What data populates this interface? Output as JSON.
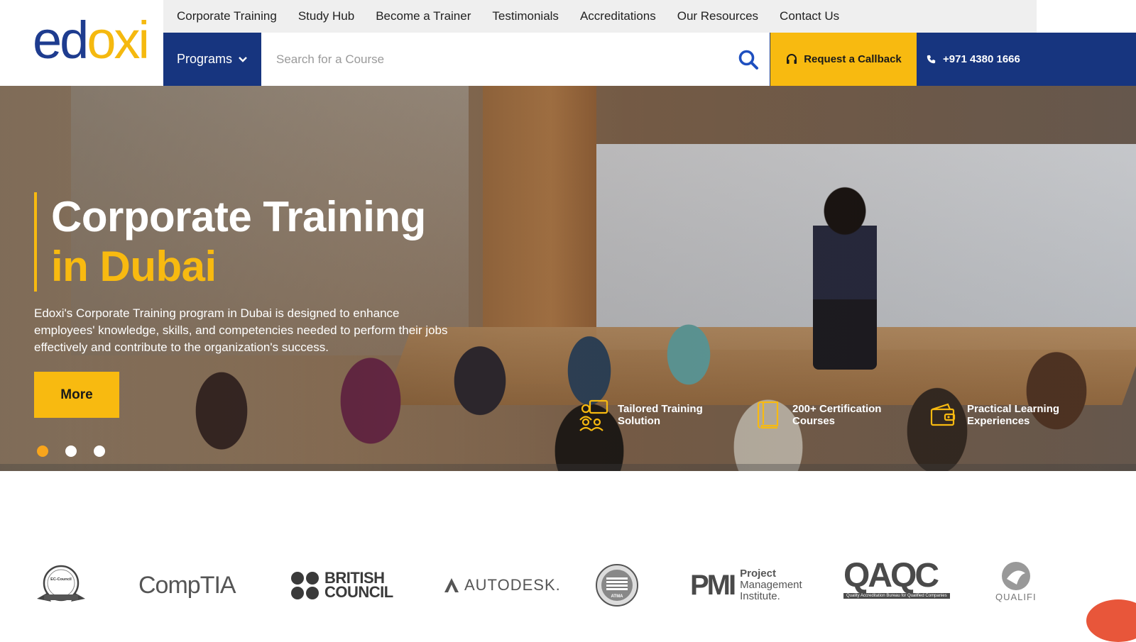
{
  "brand": {
    "logo_ed": "ed",
    "logo_o": "o",
    "logo_xi": "xi",
    "accent": "#f8ba10",
    "primary": "#17357f"
  },
  "topnav": [
    "Corporate Training",
    "Study Hub",
    "Become a Trainer",
    "Testimonials",
    "Accreditations",
    "Our Resources",
    "Contact Us"
  ],
  "header": {
    "programs_label": "Programs",
    "search_placeholder": "Search for a Course",
    "callback_label": "Request a Callback",
    "phone": "+971 4380 1666"
  },
  "hero": {
    "title_line1": "Corporate Training",
    "title_line2": "in Dubai",
    "description": "Edoxi's Corporate Training program in Dubai is designed to enhance employees' knowledge, skills, and competencies needed to perform their jobs effectively and contribute to the organization's success.",
    "cta": "More",
    "slides": 3,
    "active_slide": 1,
    "features": [
      {
        "icon": "training-icon",
        "text": "Tailored Training Solution"
      },
      {
        "icon": "book-icon",
        "text": "200+ Certification Courses"
      },
      {
        "icon": "wallet-icon",
        "text": "Practical Learning Experiences"
      }
    ]
  },
  "partners": {
    "ec_council": "EC-Council",
    "comptia": "CompTIA",
    "british_council_1": "BRITISH",
    "british_council_2": "COUNCIL",
    "autodesk": "AUTODESK.",
    "atma": "ATMA",
    "pmi_mark": "PMI",
    "pmi_line1": "Project",
    "pmi_line2": "Management",
    "pmi_line3": "Institute.",
    "qaqc": "QAQC",
    "qaqc_sub": "Quality Accreditation Bureau for Qualified Companies",
    "qualifi": "QUALIFI"
  }
}
